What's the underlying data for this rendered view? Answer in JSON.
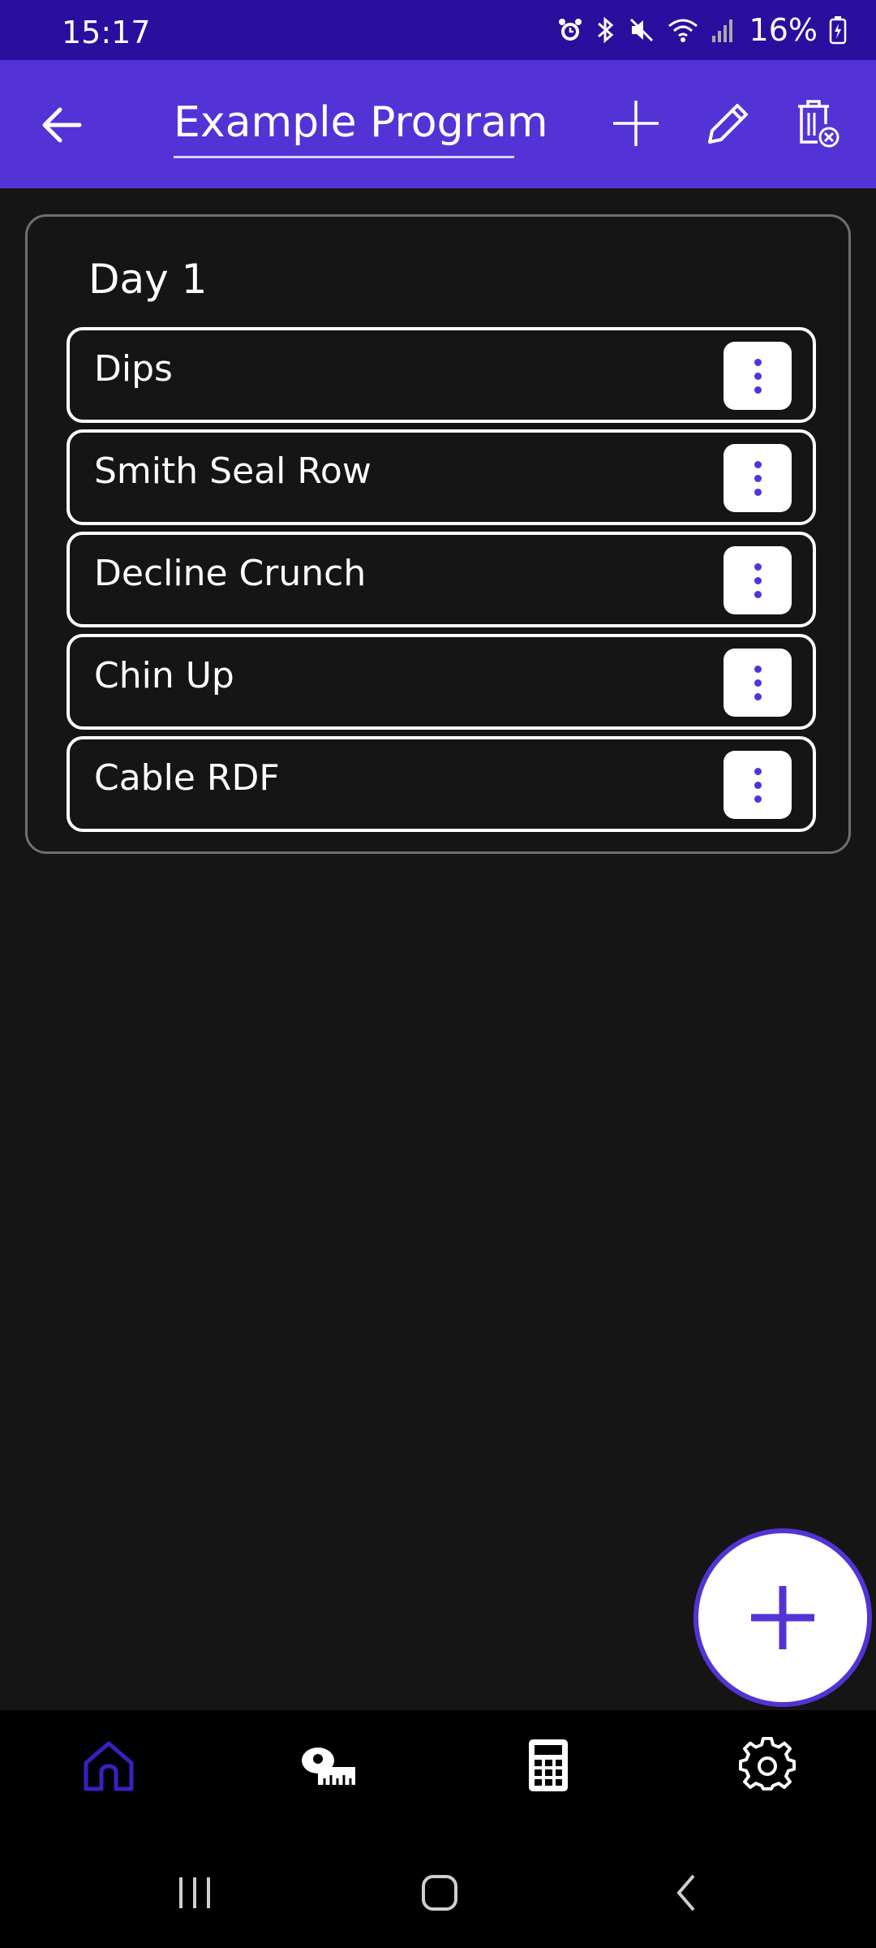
{
  "status_bar": {
    "time": "15:17",
    "battery": "16%",
    "icons": [
      "alarm-icon",
      "bluetooth-icon",
      "mute-icon",
      "wifi-icon",
      "signal-icon",
      "battery-icon"
    ]
  },
  "app_bar": {
    "title": "Example Program",
    "actions": [
      "back-arrow-icon",
      "add-icon",
      "pencil-icon",
      "delete-icon"
    ]
  },
  "day": {
    "title": "Day 1",
    "exercises": [
      {
        "name": "Dips"
      },
      {
        "name": "Smith Seal Row"
      },
      {
        "name": "Decline Crunch"
      },
      {
        "name": "Chin Up"
      },
      {
        "name": "Cable RDF"
      }
    ]
  },
  "bottom_nav": {
    "items": [
      "home-icon",
      "measuring-tape-icon",
      "calculator-icon",
      "settings-icon"
    ],
    "active": "home-icon"
  },
  "system_nav": [
    "recents-icon",
    "home-button-icon",
    "back-icon"
  ],
  "colors": {
    "accent": "#5433d6",
    "status_bar": "#2a0e9e",
    "background": "#151515",
    "nav_background": "#000000"
  }
}
